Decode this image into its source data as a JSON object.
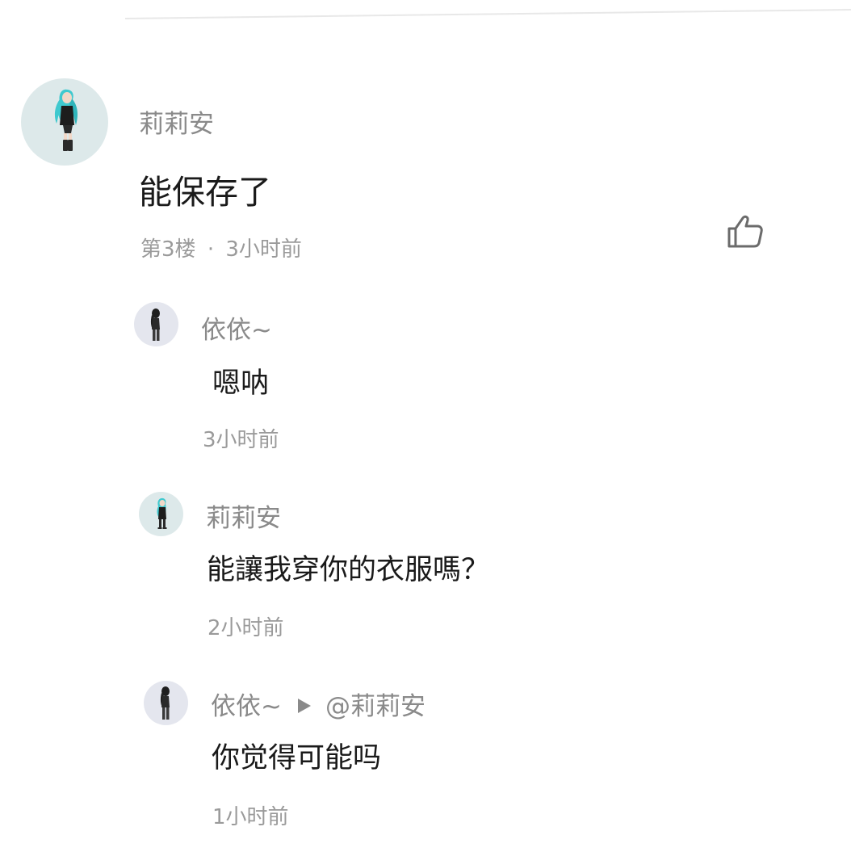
{
  "comment": {
    "author": "莉莉安",
    "text": "能保存了",
    "floor": "第3楼",
    "separator": "·",
    "time": "3小时前",
    "like_icon": "thumbs-up-icon"
  },
  "replies": [
    {
      "author": "依依~",
      "text": "嗯呐",
      "time": "3小时前"
    },
    {
      "author": "莉莉安",
      "text": "能讓我穿你的衣服嗎？",
      "time": "2小时前"
    },
    {
      "author": "依依~",
      "reply_to": "@莉莉安",
      "text": "你觉得可能吗",
      "time": "1小时前"
    }
  ],
  "colors": {
    "name": "#8a8a8a",
    "body": "#1a1a1a",
    "meta": "#9a9a9a",
    "avatar_teal": "#dde9ea",
    "avatar_lavender": "#e4e6ee",
    "hair_teal": "#3fc9cf"
  }
}
